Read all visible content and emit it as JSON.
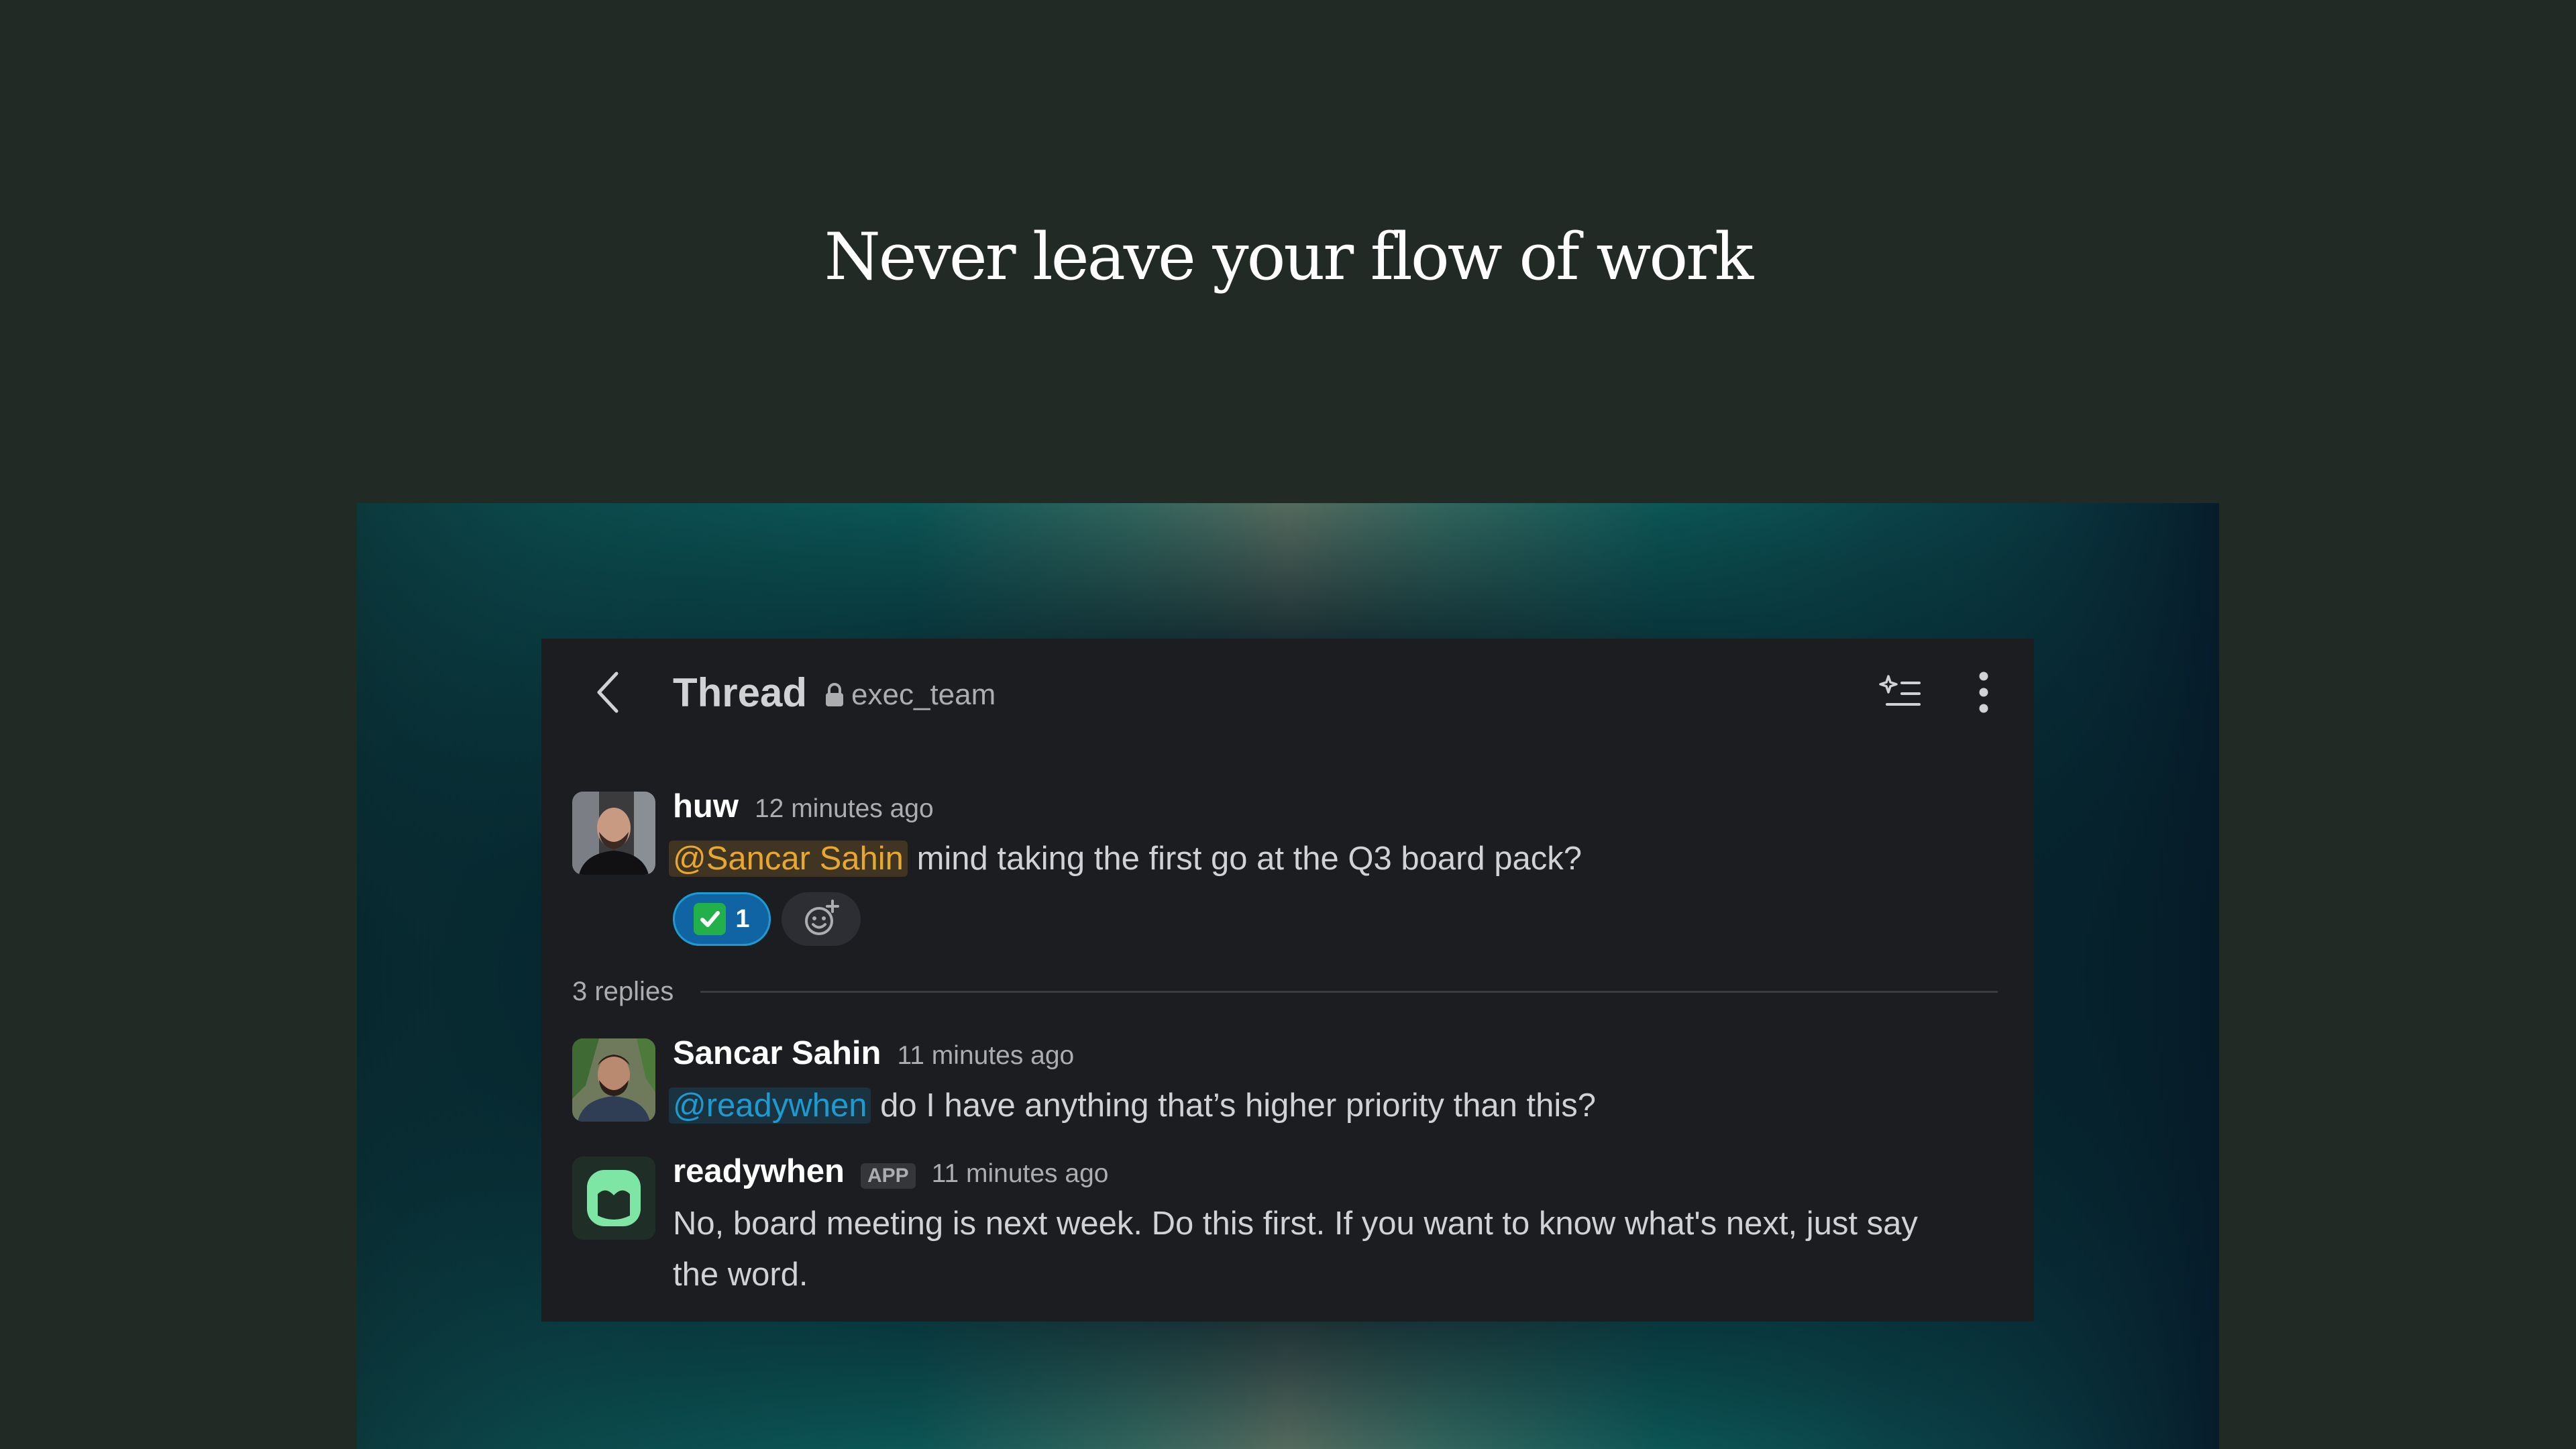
{
  "hero": {
    "headline": "Never leave your flow of work"
  },
  "thread": {
    "title": "Thread",
    "channel": "exec_team",
    "icons": {
      "back": "chevron-left-icon",
      "lock": "lock-icon",
      "summarize": "sparkle-list-icon",
      "more": "vertical-ellipsis-icon"
    },
    "parent": {
      "author": "huw",
      "time": "12 minutes ago",
      "mention": "@Sancar Sahin",
      "text": "mind taking the first go at the Q3 board pack?",
      "reaction": {
        "emoji": "white-check-mark",
        "count": "1"
      }
    },
    "replies_label": "3 replies",
    "replies": [
      {
        "author": "Sancar Sahin",
        "time": "11 minutes ago",
        "mention": "@readywhen",
        "text": "do I have anything that’s higher priority than this?"
      },
      {
        "author": "readywhen",
        "badge": "APP",
        "time": "11 minutes ago",
        "line1": "No, board meeting is next week. Do this first. If you want to know what's next, just say",
        "line2": "the word."
      }
    ]
  },
  "colors": {
    "page_bg": "#222a26",
    "panel_bg": "#1b1d21",
    "mention_yellow": "#e8a72f",
    "mention_blue": "#1d9bd1",
    "reaction_bg": "#1164a3",
    "app_logo_green": "#7ee6a4"
  }
}
